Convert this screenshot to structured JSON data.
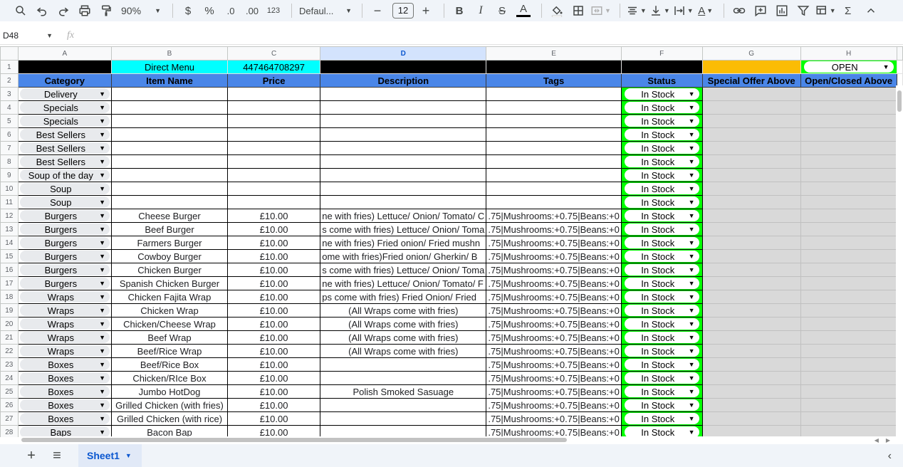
{
  "toolbar": {
    "zoom": "90%",
    "currency": "$",
    "percent": "%",
    "dec_decrease": ".0",
    "dec_increase": ".00",
    "number_format": "123",
    "font_name": "Defaul...",
    "font_size": "12",
    "bold": "B",
    "italic": "I",
    "strike": "S",
    "text_color": "A",
    "text_rotate": "A",
    "sum": "Σ"
  },
  "formula_bar": {
    "cell_ref": "D48",
    "fx": "fx",
    "value": ""
  },
  "columns": [
    "A",
    "B",
    "C",
    "D",
    "E",
    "F",
    "G",
    "H"
  ],
  "row1": {
    "b": "Direct Menu",
    "c": "447464708297",
    "h": "OPEN"
  },
  "headers": {
    "a": "Category",
    "b": "Item Name",
    "c": "Price",
    "d": "Description",
    "e": "Tags",
    "f": "Status",
    "g": "Special Offer Above",
    "h": "Open/Closed Above"
  },
  "rows": [
    {
      "n": "3",
      "cat": "Delivery",
      "item": "",
      "price": "",
      "desc": "",
      "tags": "",
      "status": "In Stock"
    },
    {
      "n": "4",
      "cat": "Specials",
      "item": "",
      "price": "",
      "desc": "",
      "tags": "",
      "status": "In Stock"
    },
    {
      "n": "5",
      "cat": "Specials",
      "item": "",
      "price": "",
      "desc": "",
      "tags": "",
      "status": "In Stock"
    },
    {
      "n": "6",
      "cat": "Best Sellers",
      "item": "",
      "price": "",
      "desc": "",
      "tags": "",
      "status": "In Stock"
    },
    {
      "n": "7",
      "cat": "Best Sellers",
      "item": "",
      "price": "",
      "desc": "",
      "tags": "",
      "status": "In Stock"
    },
    {
      "n": "8",
      "cat": "Best Sellers",
      "item": "",
      "price": "",
      "desc": "",
      "tags": "",
      "status": "In Stock"
    },
    {
      "n": "9",
      "cat": "Soup of the day",
      "item": "",
      "price": "",
      "desc": "",
      "tags": "",
      "status": "In Stock"
    },
    {
      "n": "10",
      "cat": "Soup",
      "item": "",
      "price": "",
      "desc": "",
      "tags": "",
      "status": "In Stock"
    },
    {
      "n": "11",
      "cat": "Soup",
      "item": "",
      "price": "",
      "desc": "",
      "tags": "",
      "status": "In Stock"
    },
    {
      "n": "12",
      "cat": "Burgers",
      "item": "Cheese Burger",
      "price": "£10.00",
      "desc": "ne with fries) Lettuce/ Onion/ Tomato/ C",
      "tags": ".75|Mushrooms:+0.75|Beans:+0",
      "status": "In Stock"
    },
    {
      "n": "13",
      "cat": "Burgers",
      "item": "Beef Burger",
      "price": "£10.00",
      "desc": "s come with fries) Lettuce/ Onion/ Toma",
      "tags": ".75|Mushrooms:+0.75|Beans:+0",
      "status": "In Stock"
    },
    {
      "n": "14",
      "cat": "Burgers",
      "item": "Farmers Burger",
      "price": "£10.00",
      "desc": "ne with fries) Fried onion/ Fried mushn",
      "tags": ".75|Mushrooms:+0.75|Beans:+0",
      "status": "In Stock"
    },
    {
      "n": "15",
      "cat": "Burgers",
      "item": "Cowboy Burger",
      "price": "£10.00",
      "desc": "ome with fries)Fried onion/ Gherkin/ B",
      "tags": ".75|Mushrooms:+0.75|Beans:+0",
      "status": "In Stock"
    },
    {
      "n": "16",
      "cat": "Burgers",
      "item": "Chicken Burger",
      "price": "£10.00",
      "desc": "s come with fries) Lettuce/ Onion/ Toma",
      "tags": ".75|Mushrooms:+0.75|Beans:+0",
      "status": "In Stock"
    },
    {
      "n": "17",
      "cat": "Burgers",
      "item": "Spanish Chicken Burger",
      "price": "£10.00",
      "desc": "ne with fries) Lettuce/ Onion/ Tomato/ F",
      "tags": ".75|Mushrooms:+0.75|Beans:+0",
      "status": "In Stock"
    },
    {
      "n": "18",
      "cat": "Wraps",
      "item": "Chicken Fajita Wrap",
      "price": "£10.00",
      "desc": "ps come with fries) Fried Onion/ Fried",
      "tags": ".75|Mushrooms:+0.75|Beans:+0",
      "status": "In Stock"
    },
    {
      "n": "19",
      "cat": "Wraps",
      "item": "Chicken Wrap",
      "price": "£10.00",
      "desc": "(All Wraps come with fries)",
      "tags": ".75|Mushrooms:+0.75|Beans:+0",
      "status": "In Stock"
    },
    {
      "n": "20",
      "cat": "Wraps",
      "item": "Chicken/Cheese Wrap",
      "price": "£10.00",
      "desc": "(All Wraps come with fries)",
      "tags": ".75|Mushrooms:+0.75|Beans:+0",
      "status": "In Stock"
    },
    {
      "n": "21",
      "cat": "Wraps",
      "item": "Beef Wrap",
      "price": "£10.00",
      "desc": "(All Wraps come with fries)",
      "tags": ".75|Mushrooms:+0.75|Beans:+0",
      "status": "In Stock"
    },
    {
      "n": "22",
      "cat": "Wraps",
      "item": "Beef/Rice Wrap",
      "price": "£10.00",
      "desc": "(All Wraps come with fries)",
      "tags": ".75|Mushrooms:+0.75|Beans:+0",
      "status": "In Stock"
    },
    {
      "n": "23",
      "cat": "Boxes",
      "item": "Beef/Rice Box",
      "price": "£10.00",
      "desc": "",
      "tags": ".75|Mushrooms:+0.75|Beans:+0",
      "status": "In Stock"
    },
    {
      "n": "24",
      "cat": "Boxes",
      "item": "Chicken/RIce Box",
      "price": "£10.00",
      "desc": "",
      "tags": ".75|Mushrooms:+0.75|Beans:+0",
      "status": "In Stock"
    },
    {
      "n": "25",
      "cat": "Boxes",
      "item": "Jumbo HotDog",
      "price": "£10.00",
      "desc": "Polish Smoked Sasuage",
      "tags": ".75|Mushrooms:+0.75|Beans:+0",
      "status": "In Stock"
    },
    {
      "n": "26",
      "cat": "Boxes",
      "item": "Grilled Chicken (with fries)",
      "price": "£10.00",
      "desc": "",
      "tags": ".75|Mushrooms:+0.75|Beans:+0",
      "status": "In Stock"
    },
    {
      "n": "27",
      "cat": "Boxes",
      "item": "Grilled Chicken (with rice)",
      "price": "£10.00",
      "desc": "",
      "tags": ".75|Mushrooms:+0.75|Beans:+0",
      "status": "In Stock"
    },
    {
      "n": "28",
      "cat": "Baps",
      "item": "Bacon Bap",
      "price": "£10.00",
      "desc": "",
      "tags": ".75|Mushrooms:+0.75|Beans:+0",
      "status": "In Stock"
    }
  ],
  "sheet": {
    "tab_name": "Sheet1"
  },
  "colors": {
    "header_blue": "#4a86e8",
    "cyan": "#00ffff",
    "status_green": "#00ff00",
    "offer_orange": "#fbbc04",
    "grey_fill": "#d9d9d9"
  }
}
